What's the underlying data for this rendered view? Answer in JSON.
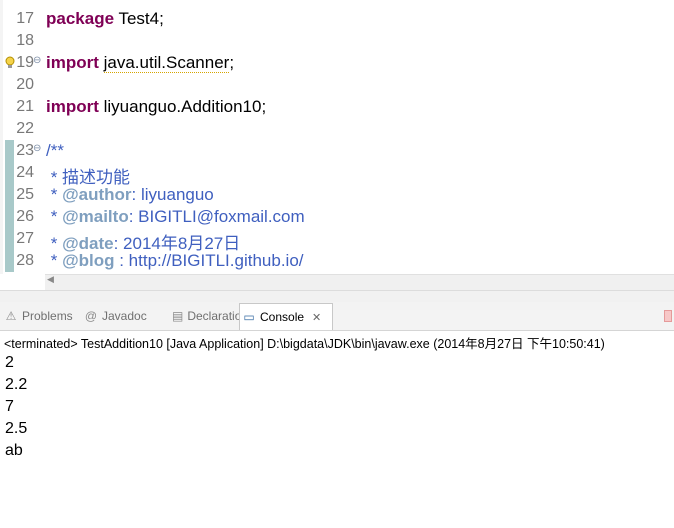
{
  "editor": {
    "lines": [
      {
        "num": "17",
        "parts": [
          {
            "t": "package",
            "c": "kw"
          },
          {
            "t": " Test4;"
          }
        ]
      },
      {
        "num": "18",
        "parts": []
      },
      {
        "num": "19",
        "warn": true,
        "fold": true,
        "parts": [
          {
            "t": "import",
            "c": "kw"
          },
          {
            "t": " "
          },
          {
            "t": "java.util.Scanner",
            "c": "warnu"
          },
          {
            "t": ";"
          }
        ]
      },
      {
        "num": "20",
        "parts": []
      },
      {
        "num": "21",
        "parts": [
          {
            "t": "import",
            "c": "kw"
          },
          {
            "t": " liyuanguo.Addition10;"
          }
        ]
      },
      {
        "num": "22",
        "parts": []
      },
      {
        "num": "23",
        "changed": true,
        "fold": true,
        "parts": [
          {
            "t": "/**",
            "c": "cm"
          }
        ]
      },
      {
        "num": "24",
        "changed": true,
        "parts": [
          {
            "t": " * 描述功能",
            "c": "cm"
          }
        ]
      },
      {
        "num": "25",
        "changed": true,
        "parts": [
          {
            "t": " * ",
            "c": "cm"
          },
          {
            "t": "@author",
            "c": "tag"
          },
          {
            "t": ": liyuanguo",
            "c": "cm"
          }
        ]
      },
      {
        "num": "26",
        "changed": true,
        "parts": [
          {
            "t": " * ",
            "c": "cm"
          },
          {
            "t": "@mailto",
            "c": "tag"
          },
          {
            "t": ": BIGITLI@foxmail.com",
            "c": "cm"
          }
        ]
      },
      {
        "num": "27",
        "changed": true,
        "parts": [
          {
            "t": " * ",
            "c": "cm"
          },
          {
            "t": "@date",
            "c": "tag"
          },
          {
            "t": ": 2014年8月27日",
            "c": "cm"
          }
        ]
      },
      {
        "num": "28",
        "changed": true,
        "parts": [
          {
            "t": " * ",
            "c": "cm"
          },
          {
            "t": "@blog",
            "c": "tag"
          },
          {
            "t": " : http://BIGITLI.github.io/",
            "c": "cm"
          }
        ]
      }
    ]
  },
  "tabs": [
    {
      "label": "Problems",
      "icon": "problems-icon",
      "glyph": "⚠"
    },
    {
      "label": "Javadoc",
      "icon": "javadoc-icon",
      "glyph": "@"
    },
    {
      "label": "Declaration",
      "icon": "declaration-icon",
      "glyph": "▤"
    },
    {
      "label": "Console",
      "icon": "console-icon",
      "glyph": "▭",
      "active": true
    }
  ],
  "console": {
    "title": "<terminated> TestAddition10 [Java Application] D:\\bigdata\\JDK\\bin\\javaw.exe (2014年8月27日 下午10:50:41)",
    "output": [
      "2",
      "2.2",
      "7",
      "2.5",
      "ab"
    ]
  }
}
